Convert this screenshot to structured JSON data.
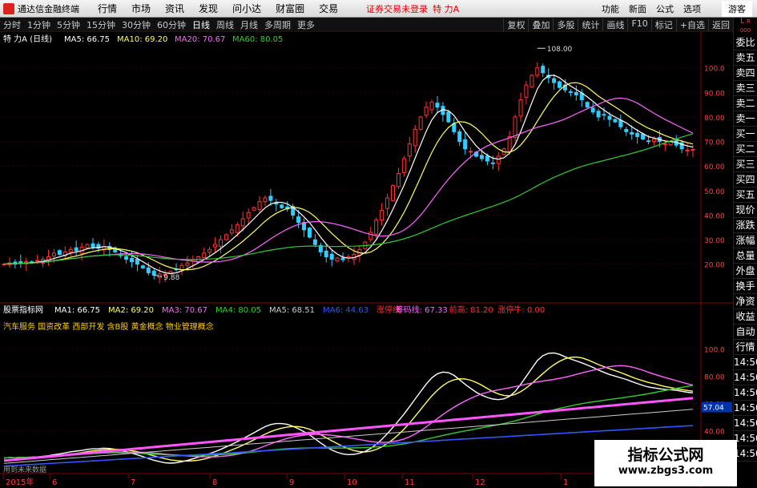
{
  "menubar": {
    "app_title": "通达信金融终端",
    "items": [
      "行情",
      "市场",
      "资讯",
      "发现",
      "问小达",
      "财富圈",
      "交易"
    ],
    "warning": "证券交易未登录",
    "stock_name": "特 力A",
    "right_items": [
      "功能",
      "新面",
      "公式",
      "选项"
    ],
    "guest": "游客"
  },
  "toolbar": {
    "periods": [
      "分时",
      "1分钟",
      "5分钟",
      "15分钟",
      "30分钟",
      "60分钟",
      "日线",
      "周线",
      "月线",
      "多周期",
      "更多"
    ],
    "active_period": "日线",
    "right_tools": [
      "复权",
      "叠加",
      "多股",
      "统计",
      "画线",
      "F10",
      "标记",
      "+自选",
      "返回"
    ]
  },
  "sidebar": {
    "corner_label": "L",
    "corner_sub": "R",
    "corner_code": "000",
    "items": [
      "委比",
      "卖五",
      "卖四",
      "卖三",
      "卖二",
      "卖一",
      "买一",
      "买二",
      "买三",
      "买四",
      "买五",
      "现价",
      "涨跌",
      "涨幅",
      "总量",
      "外盘",
      "换手",
      "净资",
      "收益",
      "自动",
      "行情",
      "14:50",
      "14:50",
      "14:50",
      "14:50",
      "14:50",
      "14:50",
      "14:50"
    ]
  },
  "main_panel": {
    "title": "特 力A (日线)",
    "legend": [
      {
        "label": "MA5: 66.75",
        "color": "#ffffff"
      },
      {
        "label": "MA10: 69.20",
        "color": "#ffff66"
      },
      {
        "label": "MA20: 70.67",
        "color": "#ff66ff"
      },
      {
        "label": "MA60: 80.05",
        "color": "#33cc33"
      }
    ],
    "high_label": "108.00",
    "low_label": "9.88",
    "y_labels": [
      "100.0",
      "90.00",
      "80.00",
      "70.00",
      "60.00",
      "50.00",
      "40.00",
      "30.00",
      "20.00"
    ]
  },
  "sub_panel": {
    "title": "股票指标网",
    "legend": [
      {
        "label": "MA1: 66.75",
        "color": "#ffffff"
      },
      {
        "label": "MA2: 69.20",
        "color": "#ffff66"
      },
      {
        "label": "MA3: 70.67",
        "color": "#ff66ff"
      },
      {
        "label": "MA4: 80.05",
        "color": "#33cc33"
      },
      {
        "label": "MA5: 68.51",
        "color": "#cccccc"
      },
      {
        "label": "MA6: 44.63",
        "color": "#3355ff"
      },
      {
        "label": "涨停线",
        "color": "#ff3333"
      },
      {
        "label": "筹码线: 67.33",
        "color": "#ff66ff"
      },
      {
        "label": "前高: 81.20",
        "color": "#ff3333"
      },
      {
        "label": "涨停牛: 0.00",
        "color": "#ff3333"
      }
    ],
    "sector_text": "汽车服务 国资改革 西部开发 含B股 黄金概念 物业管理概念",
    "current_value": "57.04",
    "bottom_caption": "用到未来数据",
    "y_labels": [
      "100.0",
      "80.00",
      "60.00",
      "40.00"
    ]
  },
  "x_axis": [
    "2015年",
    "6",
    "7",
    "8",
    "9",
    "10",
    "11",
    "12",
    "1"
  ],
  "watermark": {
    "line1": "指标公式网",
    "line2": "www.zbgs3.com"
  },
  "chart_data": {
    "type": "candlestick",
    "title": "特 力A (日线)",
    "ylim": [
      15,
      112
    ],
    "yticks": [
      20,
      30,
      40,
      50,
      60,
      70,
      80,
      90,
      100
    ],
    "annotations": [
      {
        "label": "108.00",
        "value": 108.0
      },
      {
        "label": "9.88",
        "value": 9.88
      }
    ],
    "closes": [
      20,
      20.5,
      20,
      20.8,
      21,
      20.6,
      21.5,
      22,
      23,
      24.5,
      24,
      25,
      26,
      25.5,
      27,
      28,
      27,
      26.5,
      27.2,
      26,
      25,
      23.5,
      22,
      21,
      20,
      18.5,
      16.5,
      15.5,
      16,
      15.8,
      17,
      18,
      19.5,
      20.5,
      21.8,
      23,
      24.5,
      26,
      28,
      30,
      32,
      34,
      36,
      38.5,
      41,
      43,
      45.5,
      47,
      46,
      44.5,
      43,
      42.5,
      40,
      37,
      34,
      31,
      28,
      25,
      23,
      22,
      22.5,
      21.8,
      23,
      24,
      26,
      29,
      33,
      38,
      42,
      47,
      52,
      57,
      63,
      69,
      75,
      80,
      84,
      86,
      84,
      81,
      78,
      74,
      70,
      67,
      66,
      64,
      63,
      62,
      61,
      64,
      67,
      72,
      80,
      87,
      93,
      97,
      100,
      98,
      96,
      94,
      92,
      91,
      90,
      89,
      87,
      84,
      82,
      80,
      81,
      79,
      78,
      76,
      74,
      73,
      72,
      71,
      70,
      71,
      70,
      69,
      70,
      68.5,
      67,
      66.5,
      66.75
    ],
    "ma_series": [
      {
        "name": "MA5",
        "color": "#ffffff",
        "last": 66.75
      },
      {
        "name": "MA10",
        "color": "#ffff66",
        "last": 69.2
      },
      {
        "name": "MA20",
        "color": "#ff66ff",
        "last": 70.67
      },
      {
        "name": "MA60",
        "color": "#33cc33",
        "last": 80.05
      }
    ]
  }
}
